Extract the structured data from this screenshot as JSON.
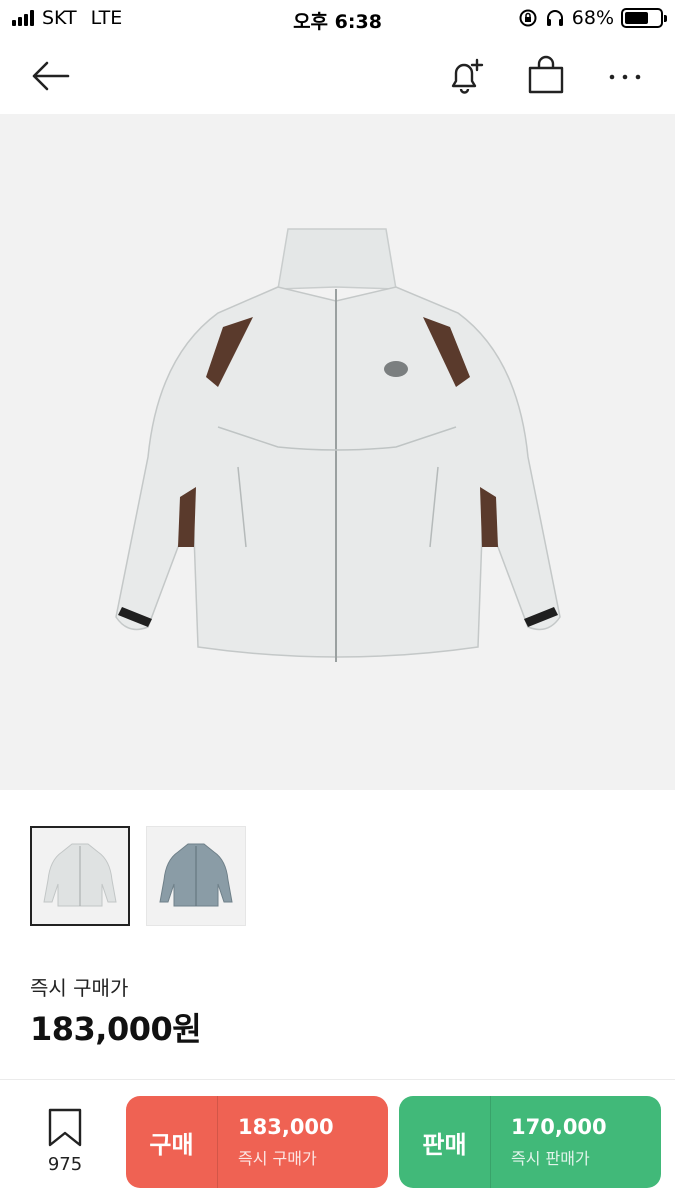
{
  "status_bar": {
    "carrier": "SKT",
    "network": "LTE",
    "time": "오후 6:38",
    "battery": "68%",
    "battery_level": 0.68
  },
  "nav": {
    "icons": [
      "back-arrow-icon",
      "bell-plus-icon",
      "shopping-bag-icon",
      "more-icon"
    ]
  },
  "product": {
    "image": "light-gray-zip-jacket",
    "thumbnails": [
      {
        "color": "#dfe2e2",
        "selected": true
      },
      {
        "color": "#8a9ca6",
        "selected": false
      }
    ]
  },
  "price": {
    "label": "즉시 구매가",
    "value": "183,000원"
  },
  "bottom_bar": {
    "wish_count": "975",
    "buy": {
      "tag": "구매",
      "amount": "183,000",
      "sub": "즉시 구매가",
      "color": "#ef6253"
    },
    "sell": {
      "tag": "판매",
      "amount": "170,000",
      "sub": "즉시 판매가",
      "color": "#41b979"
    }
  }
}
